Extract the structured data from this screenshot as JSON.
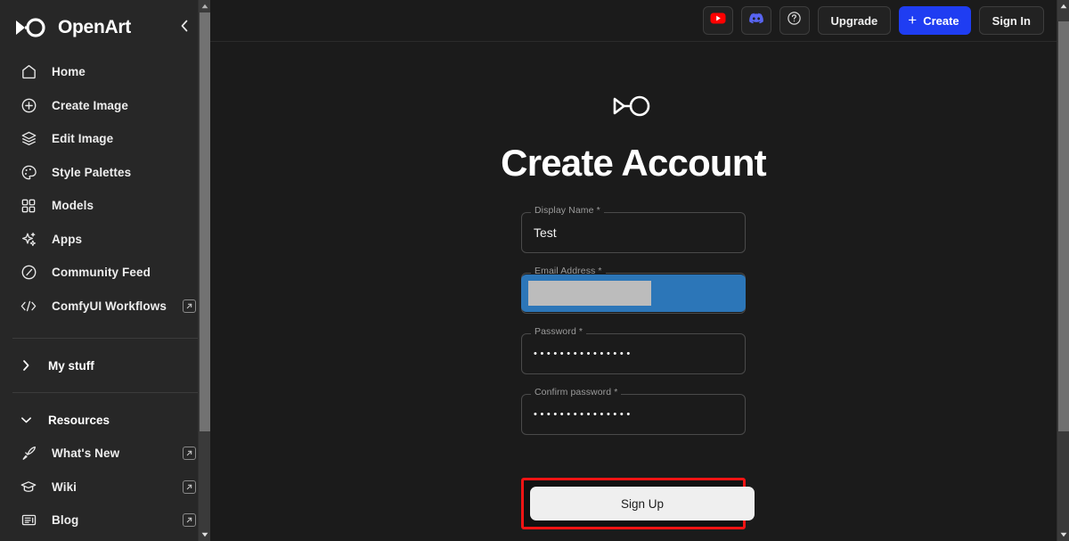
{
  "sidebar": {
    "brand": {
      "name": "OpenArt",
      "logo_icon": "openart-infinity-logo"
    },
    "collapse_icon": "chevron-left-icon",
    "nav_items": [
      {
        "label": "Home",
        "icon": "home-icon",
        "external": false
      },
      {
        "label": "Create Image",
        "icon": "plus-circle-icon",
        "external": false
      },
      {
        "label": "Edit Image",
        "icon": "layers-icon",
        "external": false
      },
      {
        "label": "Style Palettes",
        "icon": "palette-icon",
        "external": false
      },
      {
        "label": "Models",
        "icon": "grid-squares-icon",
        "external": false
      },
      {
        "label": "Apps",
        "icon": "sparkles-icon",
        "external": false
      },
      {
        "label": "Community Feed",
        "icon": "compass-icon",
        "external": false
      },
      {
        "label": "ComfyUI Workflows",
        "icon": "code-brackets-icon",
        "external": true
      }
    ],
    "my_stuff": {
      "label": "My stuff",
      "chevron_icon": "chevron-right-icon"
    },
    "resources": {
      "label": "Resources",
      "chevron_icon": "chevron-down-icon",
      "items": [
        {
          "label": "What's New",
          "icon": "rocket-icon",
          "external": true
        },
        {
          "label": "Wiki",
          "icon": "graduation-cap-icon",
          "external": true
        },
        {
          "label": "Blog",
          "icon": "news-article-icon",
          "external": true
        }
      ]
    },
    "external_badge_icon": "arrow-up-right-icon",
    "scrollbar": {
      "up_arrow_icon": "scroll-up-arrow-icon",
      "down_arrow_icon": "scroll-down-arrow-icon"
    }
  },
  "topbar": {
    "youtube_icon": "youtube-icon",
    "discord_icon": "discord-icon",
    "help_icon": "help-circle-icon",
    "upgrade_label": "Upgrade",
    "create_label": "Create",
    "create_plus_icon": "plus-icon",
    "signin_label": "Sign In",
    "create_button_color": "#1f3df2"
  },
  "main_scrollbar": {
    "up_arrow_icon": "scroll-up-arrow-icon",
    "down_arrow_icon": "scroll-down-arrow-icon"
  },
  "form": {
    "logo_icon": "openart-infinity-logo",
    "title": "Create Account",
    "fields": [
      {
        "name": "display-name",
        "label": "Display Name *",
        "value": "Test",
        "type": "text",
        "selected": false
      },
      {
        "name": "email-address",
        "label": "Email Address *",
        "value": "",
        "type": "email",
        "selected": true,
        "selection_color": "#2c76b8",
        "redacted": true
      },
      {
        "name": "password",
        "label": "Password *",
        "value": "•••••••••••••••",
        "type": "password",
        "selected": false
      },
      {
        "name": "confirm-password",
        "label": "Confirm password *",
        "value": "•••••••••••••••",
        "type": "password",
        "selected": false
      }
    ],
    "submit_label": "Sign Up",
    "highlight_color": "#f21414"
  }
}
